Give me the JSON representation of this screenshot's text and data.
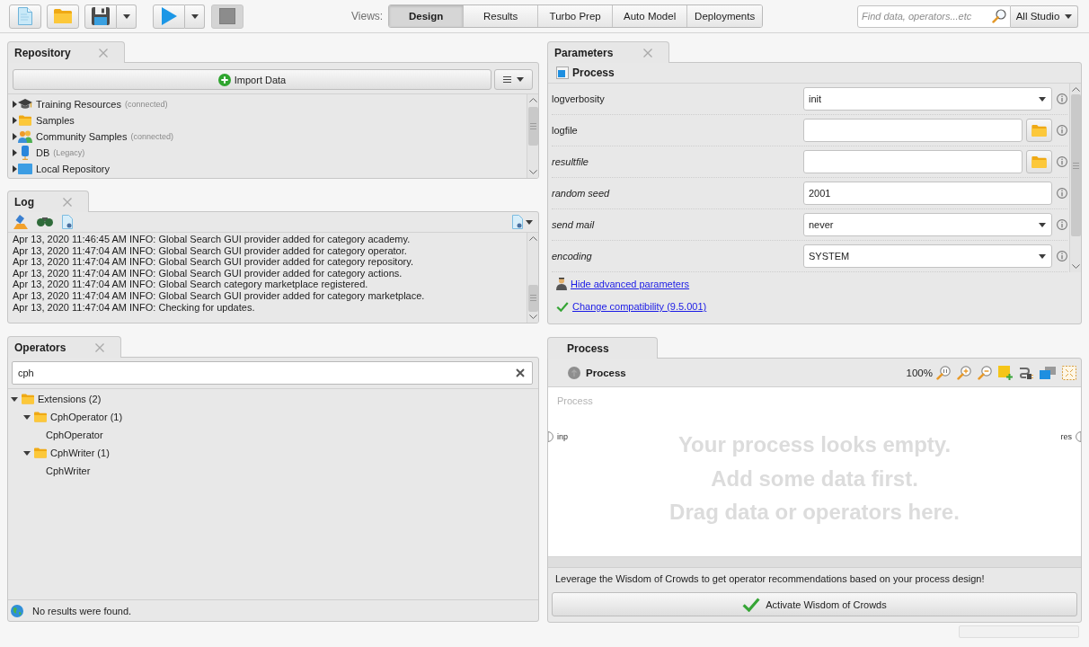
{
  "toolbar": {
    "buttons": [
      {
        "kind": "new",
        "disabled": false,
        "has_menu": false
      },
      {
        "kind": "open",
        "disabled": false,
        "has_menu": false
      },
      {
        "kind": "save",
        "disabled": false,
        "has_menu": true
      },
      {
        "kind": "run",
        "disabled": false,
        "has_menu": true
      },
      {
        "kind": "stop",
        "disabled": true,
        "has_menu": false
      }
    ]
  },
  "views": {
    "label": "Views:",
    "tabs": [
      {
        "label": "Design",
        "selected": true
      },
      {
        "label": "Results",
        "selected": false
      },
      {
        "label": "Turbo Prep",
        "selected": false
      },
      {
        "label": "Auto Model",
        "selected": false
      },
      {
        "label": "Deployments",
        "selected": false
      }
    ]
  },
  "global_search": {
    "placeholder": "Find data, operators...etc",
    "scope": "All Studio"
  },
  "repository": {
    "title": "Repository",
    "closable": true,
    "import_button": "Import Data",
    "items": [
      {
        "kind": "training",
        "label": "Training Resources",
        "note": "(connected)",
        "expanded": false
      },
      {
        "kind": "folder",
        "label": "Samples",
        "expanded": false
      },
      {
        "kind": "community",
        "label": "Community Samples",
        "note": "(connected)",
        "expanded": false
      },
      {
        "kind": "db",
        "label": "DB",
        "note": "(Legacy)",
        "expanded": false
      },
      {
        "kind": "local",
        "label": "Local Repository",
        "expanded": false
      }
    ]
  },
  "log": {
    "title": "Log",
    "closable": true,
    "lines": [
      "Apr 13, 2020 11:46:45 AM INFO: Global Search GUI provider added for category academy.",
      "Apr 13, 2020 11:47:04 AM INFO: Global Search GUI provider added for category operator.",
      "Apr 13, 2020 11:47:04 AM INFO: Global Search GUI provider added for category repository.",
      "Apr 13, 2020 11:47:04 AM INFO: Global Search GUI provider added for category actions.",
      "Apr 13, 2020 11:47:04 AM INFO: Global Search category marketplace registered.",
      "Apr 13, 2020 11:47:04 AM INFO: Global Search GUI provider added for category marketplace.",
      "Apr 13, 2020 11:47:04 AM INFO: Checking for updates."
    ]
  },
  "operators": {
    "title": "Operators",
    "closable": true,
    "search_value": "cph",
    "tree": [
      {
        "kind": "folder",
        "label": "Extensions (2)",
        "expanded": true,
        "children": [
          {
            "kind": "folder",
            "label": "CphOperator (1)",
            "expanded": true,
            "children": [
              {
                "kind": "operator",
                "label": "CphOperator"
              }
            ]
          },
          {
            "kind": "folder",
            "label": "CphWriter (1)",
            "expanded": true,
            "children": [
              {
                "kind": "operator",
                "label": "CphWriter"
              }
            ]
          }
        ]
      }
    ],
    "status": "No results were found."
  },
  "parameters": {
    "title": "Parameters",
    "closable": true,
    "operator": "Process",
    "rows": [
      {
        "name": "logverbosity",
        "kind": "dropdown",
        "value": "init",
        "advanced": false
      },
      {
        "name": "logfile",
        "kind": "file",
        "advanced": false
      },
      {
        "name": "resultfile",
        "kind": "file",
        "advanced": true
      },
      {
        "name": "random seed",
        "kind": "text",
        "value": "2001",
        "advanced": true
      },
      {
        "name": "send mail",
        "kind": "dropdown",
        "value": "never",
        "advanced": true
      },
      {
        "name": "encoding",
        "kind": "dropdown",
        "value": "SYSTEM",
        "advanced": true
      }
    ],
    "links": [
      {
        "kind": "advanced",
        "label": "Hide advanced parameters"
      },
      {
        "kind": "compatibility",
        "label": "Change compatibility (9.5.001)"
      }
    ]
  },
  "process": {
    "title": "Process",
    "closable": false,
    "breadcrumb": "Process",
    "zoom": "100%",
    "canvas_label": "Process",
    "input_port": "inp",
    "output_port": "res",
    "empty_message": [
      "Your process looks empty.",
      "Add some data first.",
      "Drag data or operators here."
    ],
    "hint": "Leverage the Wisdom of Crowds to get operator recommendations based on your process design!",
    "button": "Activate Wisdom of Crowds"
  }
}
